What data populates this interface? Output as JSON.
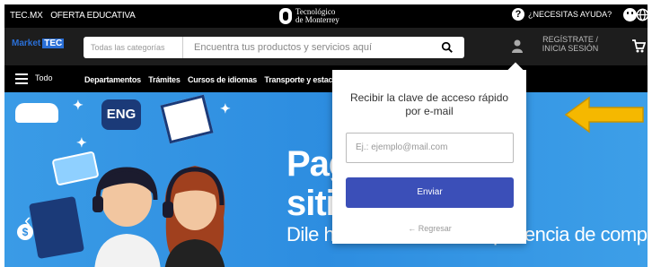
{
  "topbar": {
    "link1": "TEC.MX",
    "link2": "OFERTA EDUCATIVA",
    "logo_line1": "Tecnológico",
    "logo_line2": "de Monterrey",
    "help_label": "¿NECESITAS AYUDA?"
  },
  "searchbar": {
    "brand": "Market",
    "brand_tag": "TEC",
    "category_label": "Todas las categorías",
    "search_placeholder": "Encuentra tus productos y servicios aquí",
    "register_label": "REGÍSTRATE / INICIA SESIÓN"
  },
  "nav": {
    "menu_label": "Todo",
    "items": [
      "Departamentos",
      "Trámites",
      "Cursos de idiomas",
      "Transporte y estacionamiento"
    ]
  },
  "hero": {
    "eng_label": "ENG",
    "title_line1": "Pag    solo",
    "title_line2": "siti       s clic",
    "subtitle": "Dile hola a una nueva experiencia de compra",
    "dollar": "$"
  },
  "popup": {
    "title": "Recibir la clave de acceso rápido por e-mail",
    "email_placeholder": "Ej.: ejemplo@mail.com",
    "submit_label": "Enviar",
    "back_label": "← Regresar"
  },
  "colors": {
    "accent_button": "#3b4fb8",
    "hero_blue": "#2d8de0",
    "highlight_arrow": "#f5b800"
  }
}
